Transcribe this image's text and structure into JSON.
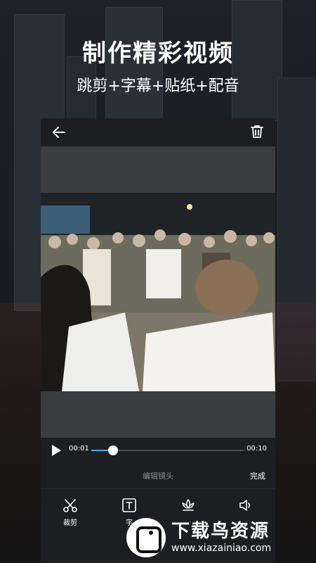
{
  "hero": {
    "title": "制作精彩视频",
    "subtitle": "跳剪+字幕+贴纸+配音"
  },
  "player": {
    "current_time": "00:01",
    "total_time": "00:10",
    "progress": 0.14
  },
  "editor": {
    "title": "编辑镜头",
    "done_label": "完成"
  },
  "tools": [
    {
      "icon": "scissors-icon",
      "label": "裁剪"
    },
    {
      "icon": "text-icon",
      "label": "字"
    },
    {
      "icon": "lotus-icon",
      "label": ""
    },
    {
      "icon": "speaker-icon",
      "label": ""
    }
  ],
  "watermark": {
    "title": "下载鸟资源",
    "site": "www.xiazainiao.com"
  },
  "colors": {
    "accent": "#3bb0ff",
    "card_bg": "#1d1e22",
    "preview_bg": "#3b3c40"
  }
}
